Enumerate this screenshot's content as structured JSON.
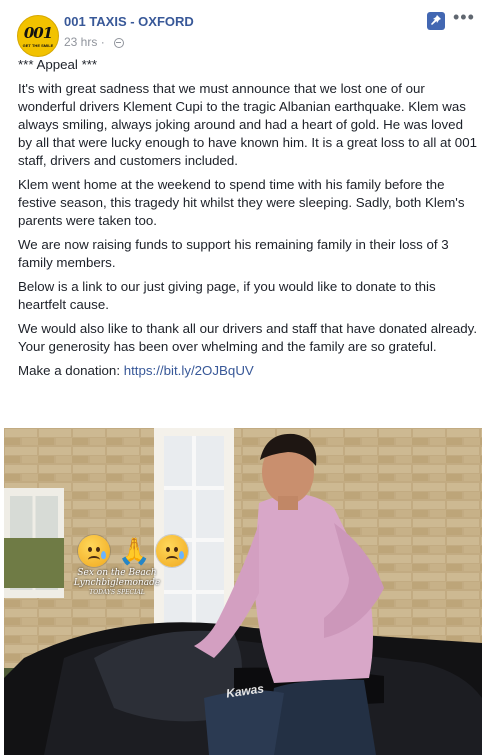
{
  "post": {
    "page_name": "001 TAXIS - OXFORD",
    "logo_text": "001",
    "logo_subtext": "GET THE SMILE",
    "timestamp": "23 hrs",
    "audience_icon": "globe-icon",
    "pinned_icon": "pin-icon",
    "more_label": "•••",
    "paragraphs": [
      "*** Appeal ***",
      "It's with great sadness that we must announce that we lost one of our wonderful drivers Klement Cupi to the tragic Albanian earthquake. Klem was always smiling, always joking around and had a heart of gold. He was loved by all that were lucky enough to have known him. It is a great loss to all at 001 staff, drivers and customers included.",
      "Klem went home at the weekend to spend time with his family before the festive season, this tragedy hit whilst they were sleeping. Sadly, both Klem's parents were taken too.",
      "We are now raising funds to support his remaining family in their loss of 3 family members.",
      "Below is a link to our just giving page, if you would like to donate to this heartfelt cause.",
      "We would also like to thank all our drivers and staff that have donated already. Your generosity has been over whelming and the family are so grateful."
    ],
    "donation_prefix": "Make a donation: ",
    "donation_link": "https://bit.ly/2OJBqUV"
  },
  "photo": {
    "stickers": [
      "sad-tear-emoji",
      "praying-hands-emoji",
      "sad-tear-emoji"
    ],
    "tank_text_line1": "Sex on the Beach",
    "tank_text_line2": "Lynchbiglemonade",
    "tank_text_line3": "TODAYS SPECIAL",
    "bike_brand": "Kawas"
  },
  "colors": {
    "link": "#385898",
    "text": "#1d2129",
    "meta": "#90949c",
    "pin_bg": "#4267b2",
    "logo_yellow": "#f2c200"
  }
}
